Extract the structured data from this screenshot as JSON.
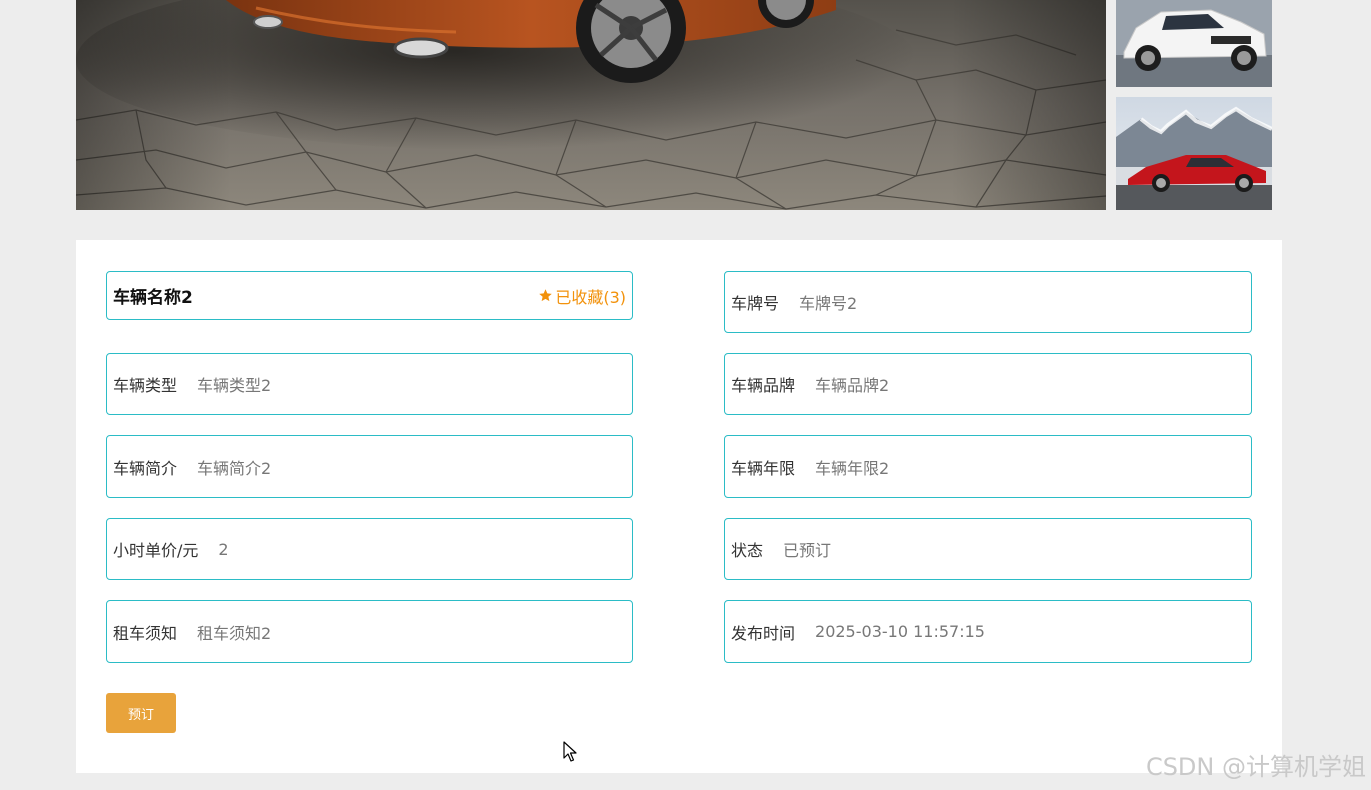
{
  "car": {
    "name": "车辆名称2",
    "favorite_label": "已收藏(3)"
  },
  "fields_left": [
    {
      "label": "车辆类型",
      "value": "车辆类型2"
    },
    {
      "label": "车辆简介",
      "value": "车辆简介2"
    },
    {
      "label": "小时单价/元",
      "value": "2"
    },
    {
      "label": "租车须知",
      "value": "租车须知2"
    }
  ],
  "fields_right": [
    {
      "label": "车牌号",
      "value": "车牌号2"
    },
    {
      "label": "车辆品牌",
      "value": "车辆品牌2"
    },
    {
      "label": "车辆年限",
      "value": "车辆年限2"
    },
    {
      "label": "状态",
      "value": "已预订"
    },
    {
      "label": "发布时间",
      "value": "2025-03-10 11:57:15"
    }
  ],
  "actions": {
    "book_label": "预订"
  },
  "watermark": "CSDN @计算机学姐",
  "colors": {
    "field_border": "#2bbcc6",
    "favorite": "#f2920c",
    "book_button": "#e8a33b"
  },
  "icons": {
    "favorite": "star-icon",
    "cursor": "mouse-cursor-icon"
  }
}
